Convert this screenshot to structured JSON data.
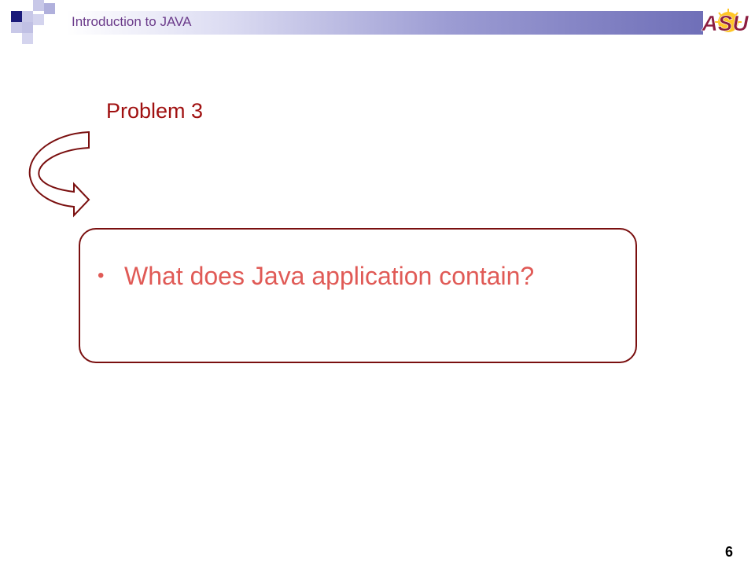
{
  "header": {
    "title": "Introduction to JAVA",
    "logo_text": "ASU"
  },
  "slide": {
    "problem_title": "Problem 3",
    "bullet_symbol": "•",
    "question": "What does Java application contain?"
  },
  "footer": {
    "page_number": "6"
  },
  "colors": {
    "title_red": "#a01010",
    "box_border": "#7a0f0f",
    "question_text": "#e05a56",
    "header_text": "#6a3a8a",
    "decor_navy": "#1a1a7a",
    "decor_lavender": "#b8b8e0",
    "logo_maroon": "#8c1d40",
    "logo_gold": "#ffc627"
  }
}
